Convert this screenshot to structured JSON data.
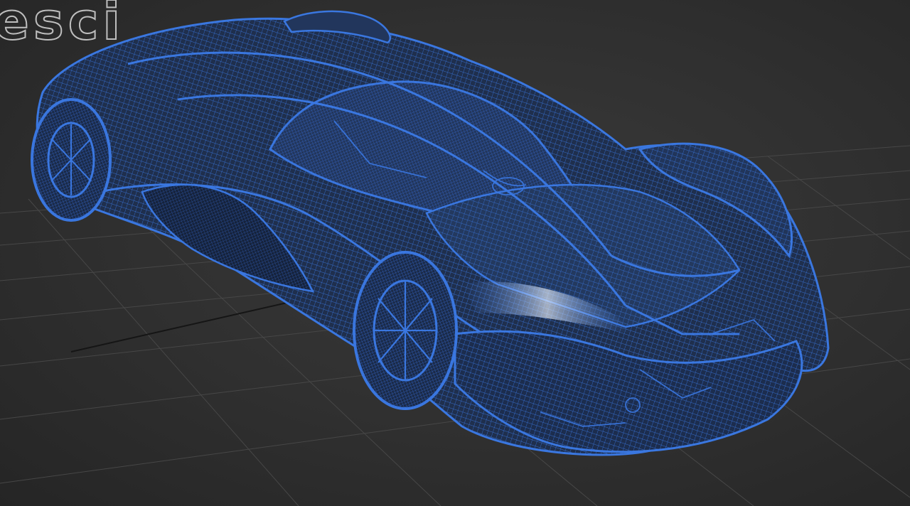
{
  "viewport": {
    "label_fragment": "esci",
    "shading_mode": "wireframe",
    "model_name": "sports-car-mesh"
  },
  "colors": {
    "background": "#2f2f2f",
    "grid_line": "#4a4a4a",
    "grid_axis": "#141414",
    "wire": "#3a77e0",
    "wire_dense": "#2c5cbf",
    "highlight": "#d8e4f5"
  },
  "icons": {
    "viewcube": "viewcube-icon"
  }
}
